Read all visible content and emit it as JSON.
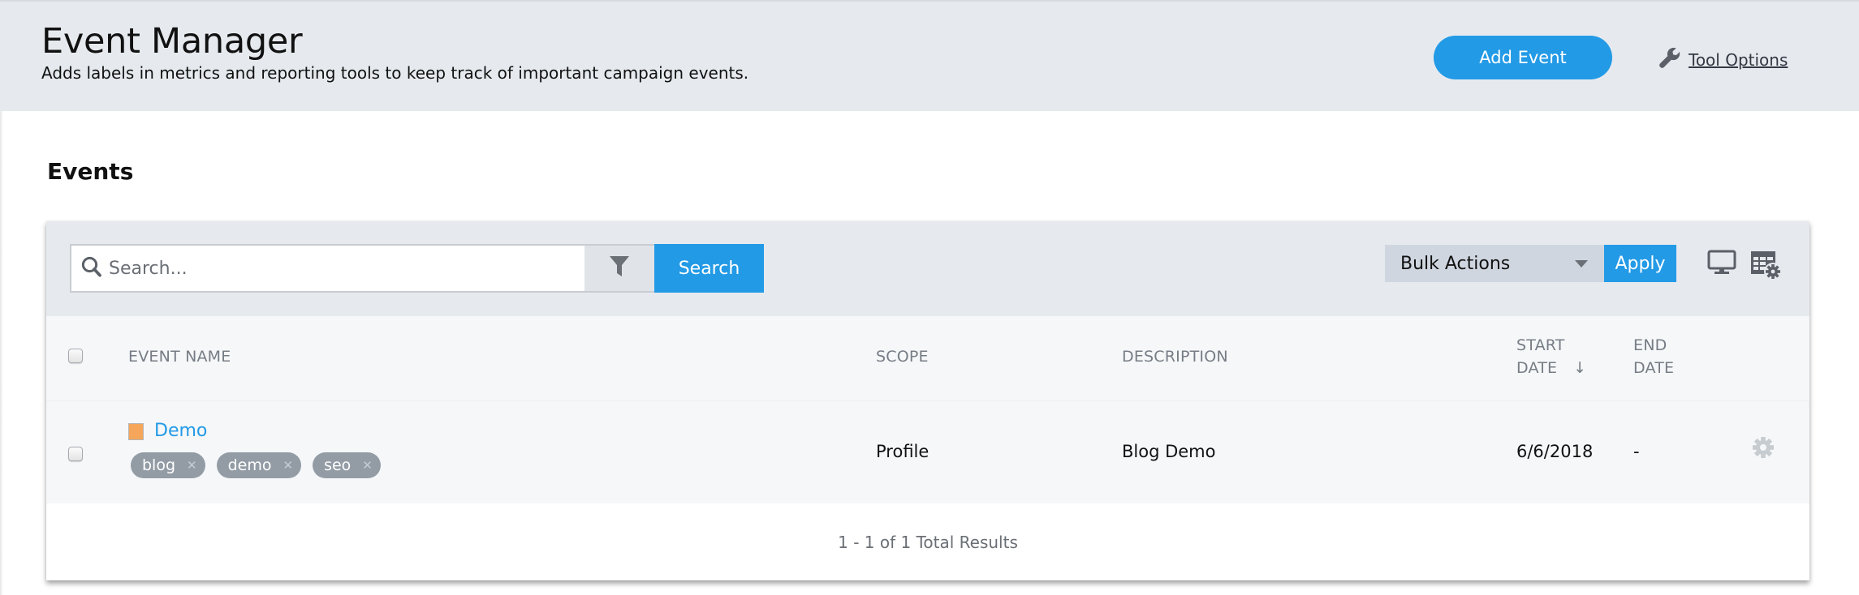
{
  "header": {
    "title": "Event Manager",
    "subtitle": "Adds labels in metrics and reporting tools to keep track of important campaign events.",
    "add_event_label": "Add Event",
    "tool_options_label": "Tool Options",
    "tool_options_icon": "wrench-icon"
  },
  "section": {
    "title": "Events"
  },
  "toolbar": {
    "search_placeholder": "Search...",
    "search_value": "",
    "search_icon": "search-icon",
    "filter_icon": "filter-icon",
    "search_button_label": "Search",
    "bulk_actions_selected": "Bulk Actions",
    "apply_label": "Apply",
    "view_icon": "monitor-icon",
    "columns_icon": "table-settings-icon"
  },
  "table": {
    "columns": {
      "event_name": "EVENT NAME",
      "scope": "SCOPE",
      "description": "DESCRIPTION",
      "start_date_line1": "START",
      "start_date_line2": "DATE",
      "sort_indicator": "↓",
      "end_date_line1": "END",
      "end_date_line2": "DATE"
    },
    "rows": [
      {
        "name": "Demo",
        "color": "#f5a65b",
        "tags": [
          "blog",
          "demo",
          "seo"
        ],
        "tag_remove_glyph": "✕",
        "scope": "Profile",
        "description": "Blog Demo",
        "start_date": "6/6/2018",
        "end_date": "-"
      }
    ],
    "footer_text": "1 - 1 of 1 Total Results"
  },
  "colors": {
    "accent": "#239ae6",
    "header_bg": "#e6eaee",
    "tag_bg": "#939ca5"
  }
}
